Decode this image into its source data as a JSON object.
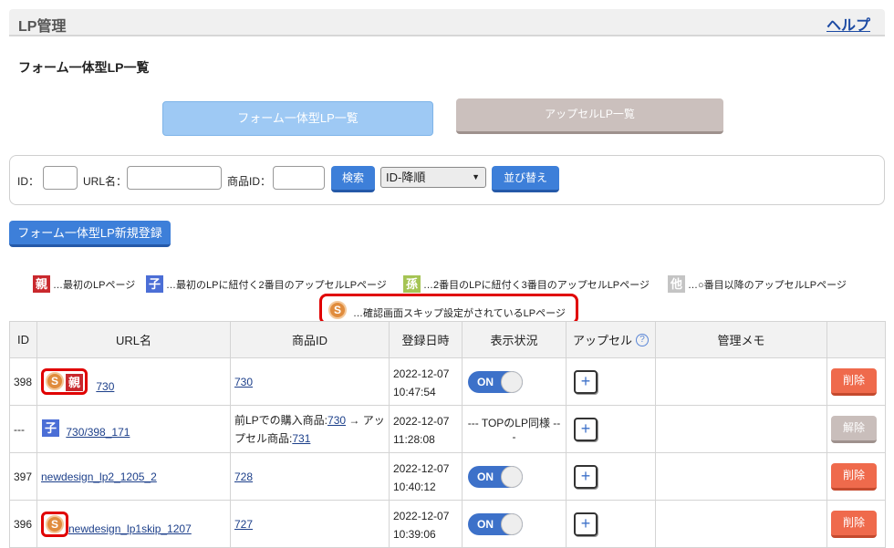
{
  "header": {
    "title": "LP管理",
    "help": "ヘルプ"
  },
  "page_title": "フォーム一体型LP一覧",
  "tabs": {
    "form": "フォーム一体型LP一覧",
    "upsell": "アップセルLP一覧"
  },
  "search": {
    "id_label": "ID：",
    "url_label": "URL名：",
    "product_label": "商品ID：",
    "search_button": "検索",
    "sort_select": "ID-降順",
    "sort_button": "並び替え"
  },
  "new_button": "フォーム一体型LP新規登録",
  "legend": {
    "oya": {
      "badge": "親",
      "text": "…最初のLPページ"
    },
    "ko": {
      "badge": "子",
      "text": "…最初のLPに紐付く2番目のアップセルLPページ"
    },
    "mago": {
      "badge": "孫",
      "text": "…2番目のLPに紐付く3番目のアップセルLPページ"
    },
    "ta": {
      "badge": "他",
      "text": "…○番目以降のアップセルLPページ"
    },
    "skip": {
      "icon": "S",
      "text": "…確認画面スキップ設定がされているLPページ"
    }
  },
  "table": {
    "headers": {
      "id": "ID",
      "url": "URL名",
      "product": "商品ID",
      "date": "登録日時",
      "status": "表示状況",
      "upsell": "アップセル",
      "memo": "管理メモ"
    },
    "rows": [
      {
        "id": "398",
        "skip": "S",
        "badge": "親",
        "url": "730",
        "product": "730",
        "date1": "2022-12-07",
        "date2": "10:47:54",
        "status": "ON",
        "action": "削除"
      },
      {
        "id": "---",
        "badge": "子",
        "url": "730/398_171",
        "product_pre": "前LPでの購入商品:",
        "product_a": "730",
        "product_mid": " → アップセル商品:",
        "product_b": "731",
        "date1": "2022-12-07",
        "date2": "11:28:08",
        "status_text": "--- TOPのLP同様 ---",
        "action": "解除"
      },
      {
        "id": "397",
        "url": "newdesign_lp2_1205_2",
        "product": "728",
        "date1": "2022-12-07",
        "date2": "10:40:12",
        "status": "ON",
        "action": "削除"
      },
      {
        "id": "396",
        "skip": "S",
        "url": "newdesign_lp1skip_1207",
        "product": "727",
        "date1": "2022-12-07",
        "date2": "10:39:06",
        "status": "ON",
        "action": "削除"
      }
    ]
  },
  "colors": {
    "accent_blue": "#3d7fd9",
    "delete_red": "#ef6a4c",
    "highlight_red": "#e00000"
  }
}
